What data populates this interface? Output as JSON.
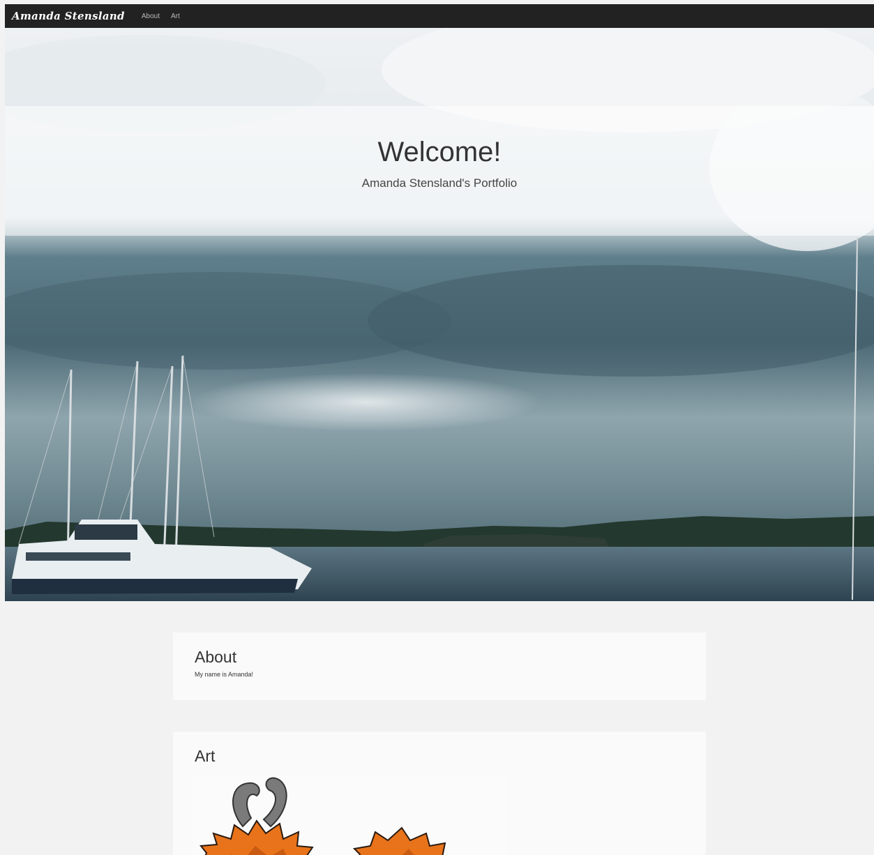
{
  "navbar": {
    "brand": "Amanda Stensland",
    "links": [
      {
        "label": "About"
      },
      {
        "label": "Art"
      }
    ]
  },
  "hero": {
    "title": "Welcome!",
    "subtitle": "Amanda Stensland's Portfolio"
  },
  "about": {
    "heading": "About",
    "text": "My name is Amanda!"
  },
  "art": {
    "heading": "Art"
  },
  "colors": {
    "navbar": "#222222",
    "page_background": "#f2f2f2",
    "card_background": "#fafafa",
    "fur_orange": "#e8731a",
    "horn_gray": "#7a7a7a"
  }
}
